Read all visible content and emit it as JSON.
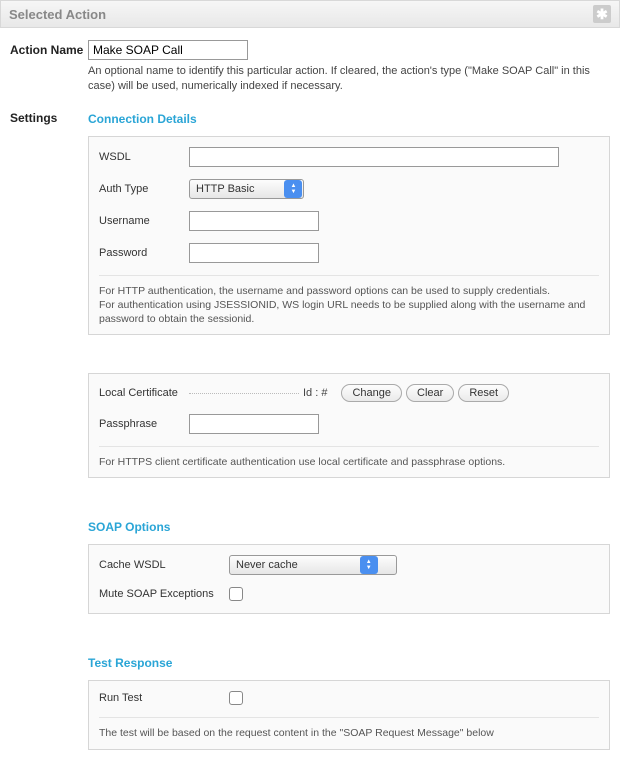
{
  "header": {
    "title": "Selected Action"
  },
  "labels": {
    "action_name": "Action Name",
    "settings": "Settings"
  },
  "action": {
    "name_value": "Make SOAP Call",
    "hint": "An optional name to identify this particular action. If cleared, the action's type (\"Make SOAP Call\" in this case) will be used, numerically indexed if necessary."
  },
  "connection": {
    "title": "Connection Details",
    "wsdl_label": "WSDL",
    "wsdl_value": "",
    "auth_type_label": "Auth Type",
    "auth_type_value": "HTTP Basic",
    "username_label": "Username",
    "username_value": "",
    "password_label": "Password",
    "password_value": "",
    "note_line1": "For HTTP authentication, the username and password options can be used to supply credentials.",
    "note_line2": "For authentication using JSESSIONID, WS login URL needs to be supplied along with the username and password to obtain the sessionid.",
    "cert_label": "Local Certificate",
    "cert_id_prefix": "Id : #",
    "cert_id_value": "",
    "change_btn": "Change",
    "clear_btn": "Clear",
    "reset_btn": "Reset",
    "passphrase_label": "Passphrase",
    "passphrase_value": "",
    "cert_note": "For HTTPS client certificate authentication use local certificate and passphrase options."
  },
  "soap": {
    "title": "SOAP Options",
    "cache_label": "Cache WSDL",
    "cache_value": "Never cache",
    "mute_label": "Mute SOAP Exceptions",
    "mute_checked": false
  },
  "test": {
    "title": "Test Response",
    "run_label": "Run Test",
    "run_checked": false,
    "note": "The test will be based on the request content in the \"SOAP Request Message\" below"
  }
}
